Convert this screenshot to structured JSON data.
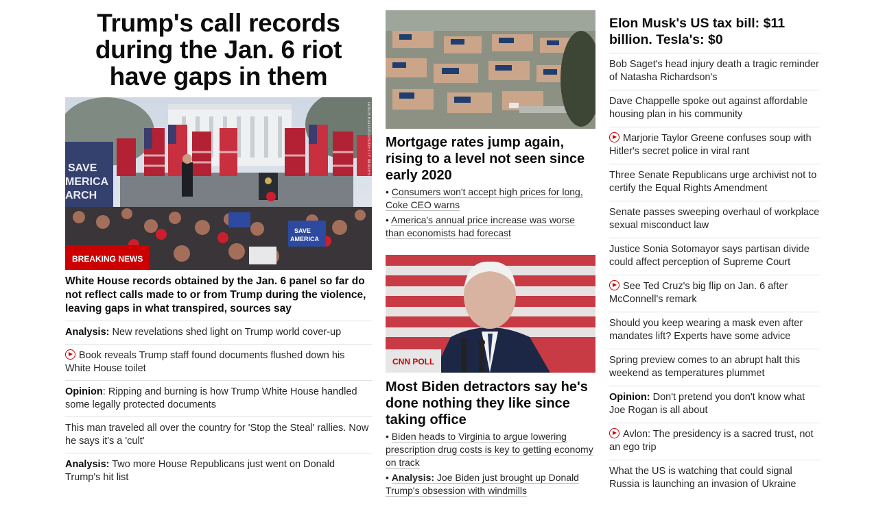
{
  "col1": {
    "lead_title": "Trump's call records during the Jan. 6 riot have gaps in them",
    "badge": "BREAKING NEWS",
    "image_credit": "TASOS KATOPODIS/GETTY IMAGES",
    "sign_text_1": "SAVE AMERICA MARCH",
    "sign_text_2": "SAVE AMERICA",
    "lead_sub": "White House records obtained by the Jan. 6 panel so far do not reflect calls made to or from Trump during the violence, leaving gaps in what transpired, sources say",
    "items": [
      {
        "prefix": "Analysis:",
        "text": " New revelations shed light on Trump world cover-up",
        "video": false
      },
      {
        "prefix": "",
        "text": "Book reveals Trump staff found documents flushed down his White House toilet",
        "video": true
      },
      {
        "prefix": "Opinion",
        "text": ": Ripping and burning is how Trump White House handled some legally protected documents",
        "video": false
      },
      {
        "prefix": "",
        "text": "This man traveled all over the country for 'Stop the Steal' rallies. Now he says it's a 'cult'",
        "video": false
      },
      {
        "prefix": "Analysis:",
        "text": " Two more House Republicans just went on Donald Trump's hit list",
        "video": false
      }
    ]
  },
  "col2": {
    "story1": {
      "title": "Mortgage rates jump again, rising to a level not seen since early 2020",
      "bullets": [
        {
          "prefix": "",
          "text": "Consumers won't accept high prices for long, Coke CEO warns"
        },
        {
          "prefix": "",
          "text": "America's annual price increase was worse than economists had forecast"
        }
      ]
    },
    "story2": {
      "badge": "CNN POLL",
      "title": "Most Biden detractors say he's done nothing they like since taking office",
      "bullets": [
        {
          "prefix": "",
          "text": "Biden heads to Virginia to argue lowering prescription drug costs is key to getting economy on track"
        },
        {
          "prefix": "Analysis:",
          "text": " Joe Biden just brought up Donald Trump's obsession with windmills"
        }
      ]
    }
  },
  "col3": {
    "title": "Elon Musk's US tax bill: $11 billion. Tesla's: $0",
    "items": [
      {
        "prefix": "",
        "text": "Bob Saget's head injury death a tragic reminder of Natasha Richardson's",
        "video": false
      },
      {
        "prefix": "",
        "text": "Dave Chappelle spoke out against affordable housing plan in his community",
        "video": false
      },
      {
        "prefix": "",
        "text": "Marjorie Taylor Greene confuses soup with Hitler's secret police in viral rant",
        "video": true
      },
      {
        "prefix": "",
        "text": "Three Senate Republicans urge archivist not to certify the Equal Rights Amendment",
        "video": false
      },
      {
        "prefix": "",
        "text": "Senate passes sweeping overhaul of workplace sexual misconduct law",
        "video": false
      },
      {
        "prefix": "",
        "text": "Justice Sonia Sotomayor says partisan divide could affect perception of Supreme Court",
        "video": false
      },
      {
        "prefix": "",
        "text": "See Ted Cruz's big flip on Jan. 6 after McConnell's remark",
        "video": true
      },
      {
        "prefix": "",
        "text": "Should you keep wearing a mask even after mandates lift? Experts have some advice",
        "video": false
      },
      {
        "prefix": "",
        "text": "Spring preview comes to an abrupt halt this weekend as temperatures plummet",
        "video": false
      },
      {
        "prefix": "Opinion:",
        "text": " Don't pretend you don't know what Joe Rogan is all about",
        "video": false
      },
      {
        "prefix": "",
        "text": "Avlon: The presidency is a sacred trust, not an ego trip",
        "video": true
      },
      {
        "prefix": "",
        "text": "What the US is watching that could signal Russia is launching an invasion of Ukraine",
        "video": false
      }
    ]
  },
  "colors": {
    "brand_red": "#cc0000",
    "text": "#0c0c0c",
    "divider": "#e2e2e2"
  }
}
